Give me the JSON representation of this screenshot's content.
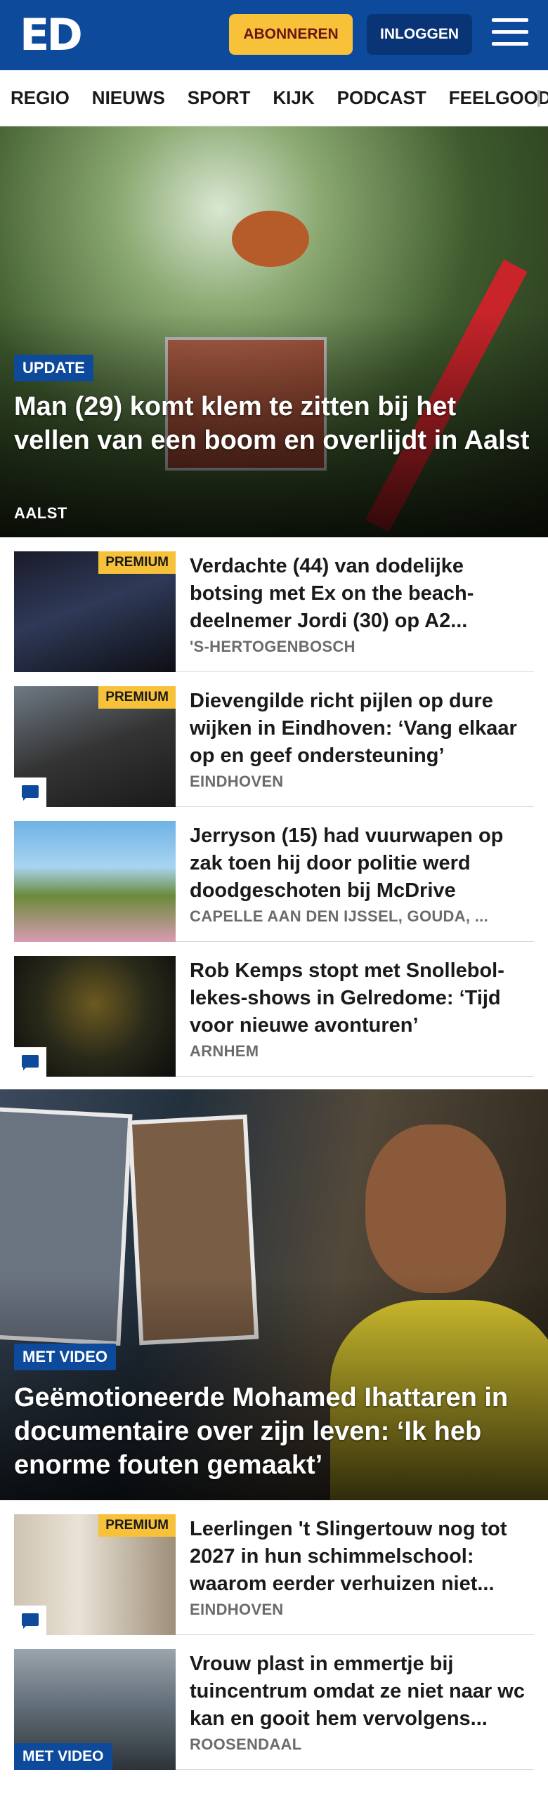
{
  "header": {
    "logo": "ED",
    "subscribe_label": "ABONNEREN",
    "login_label": "INLOGGEN",
    "brand_color": "#0d4a9c",
    "accent_color": "#f7c23a"
  },
  "nav": {
    "items": [
      "REGIO",
      "NIEUWS",
      "SPORT",
      "KIJK",
      "PODCAST",
      "FEELGOOD"
    ]
  },
  "hero1": {
    "badge": "UPDATE",
    "title": "Man (29) komt klem te zitten bij het vellen van een boom en overlijdt in Aalst",
    "location": "AALST"
  },
  "articles1": [
    {
      "title": "Verdachte (44) van dodelijke botsing met Ex on the beach-deelnemer Jordi (30) op A2...",
      "location": "'S-HERTOGENBOSCH",
      "premium": "PREMIUM"
    },
    {
      "title": "Dievengilde richt pijlen op dure wijken in Eindhoven: ‘Vang elkaar op en geef ondersteuning’",
      "location": "EINDHOVEN",
      "premium": "PREMIUM"
    },
    {
      "title": "Jerryson (15) had vuurwapen op zak toen hij door politie werd doodgeschoten bij McDrive",
      "location": "CAPELLE AAN DEN IJSSEL, GOUDA, ..."
    },
    {
      "title": "Rob Kemps stopt met Snollebol-lekes-shows in Gelredome: ‘Tijd voor nieuwe avonturen’",
      "location": "ARNHEM"
    }
  ],
  "hero2": {
    "badge": "MET VIDEO",
    "title": "Geëmotioneerde Mohamed Ihattaren in documentaire over zijn leven: ‘Ik heb enorme fouten gemaakt’"
  },
  "articles2": [
    {
      "title": "Leerlingen 't Slingertouw nog tot 2027 in hun schimmelschool: waarom eerder verhuizen niet...",
      "location": "EINDHOVEN",
      "premium": "PREMIUM"
    },
    {
      "title": "Vrouw plast in emmertje bij tuincentrum omdat ze niet naar wc kan en gooit hem vervolgens...",
      "location": "ROOSENDAAL",
      "video": "MET VIDEO"
    }
  ]
}
